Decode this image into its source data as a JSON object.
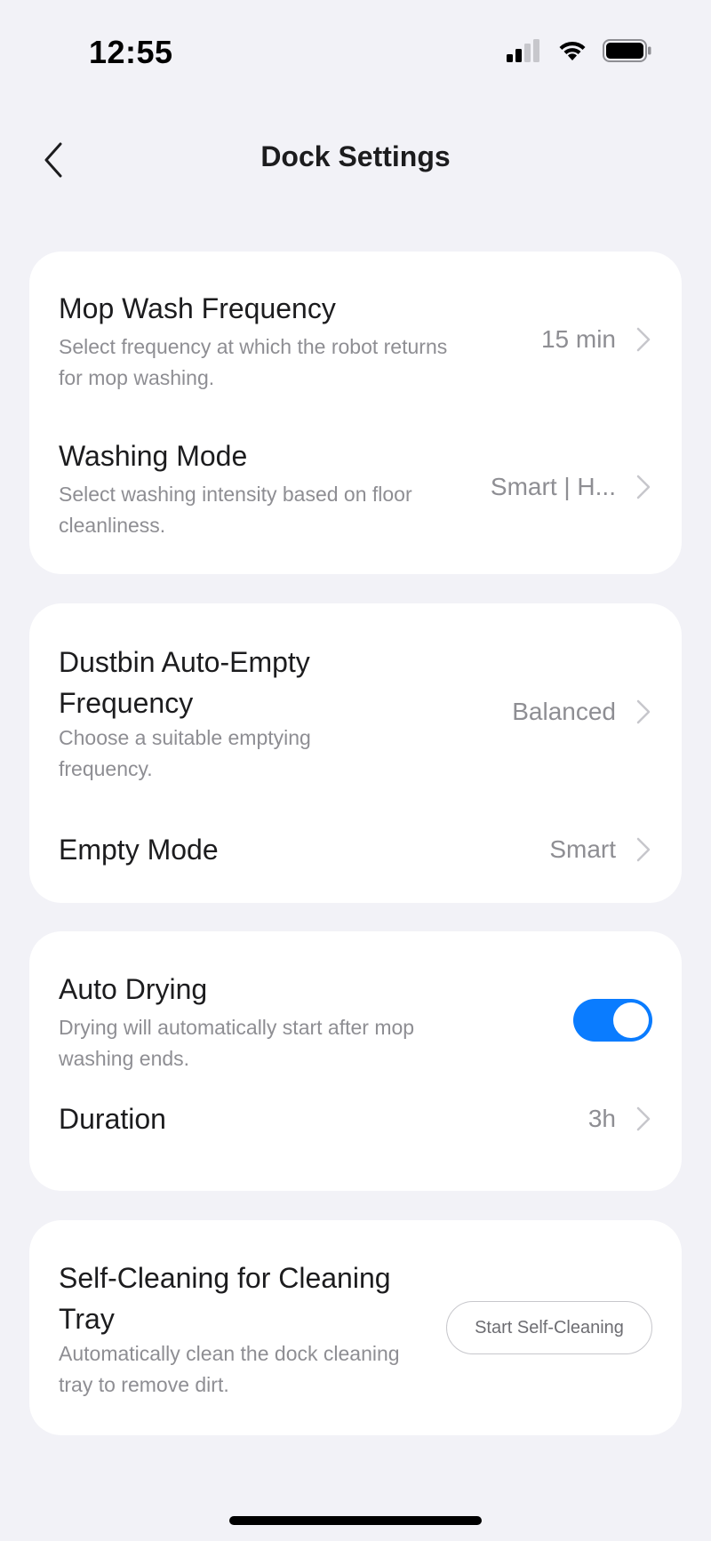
{
  "status_bar": {
    "time": "12:55",
    "icons": [
      "cellular-signal-icon",
      "wifi-icon",
      "battery-icon"
    ]
  },
  "nav": {
    "title": "Dock Settings",
    "back_icon": "chevron-left-icon"
  },
  "cards": {
    "mop": {
      "wash_frequency": {
        "title": "Mop Wash Frequency",
        "desc": "Select frequency at which the robot returns for mop washing.",
        "value": "15 min"
      },
      "washing_mode": {
        "title": "Washing Mode",
        "desc": "Select washing intensity based on floor cleanliness.",
        "value": "Smart | H..."
      }
    },
    "dustbin": {
      "auto_empty": {
        "title": "Dustbin Auto-Empty Frequency",
        "desc": "Choose a suitable emptying frequency.",
        "value": "Balanced"
      },
      "empty_mode": {
        "title": "Empty Mode",
        "value": "Smart"
      }
    },
    "drying": {
      "auto_drying": {
        "title": "Auto Drying",
        "desc": "Drying will automatically start after mop washing ends.",
        "enabled": true
      },
      "duration": {
        "title": "Duration",
        "value": "3h"
      }
    },
    "tray": {
      "self_cleaning": {
        "title": "Self-Cleaning for Cleaning Tray",
        "desc": "Automatically clean the dock cleaning tray to remove dirt.",
        "button_label": "Start Self-Cleaning"
      }
    }
  },
  "colors": {
    "background": "#f2f2f7",
    "card": "#ffffff",
    "accent": "#0a7cff",
    "secondary_text": "#8e8e93"
  }
}
